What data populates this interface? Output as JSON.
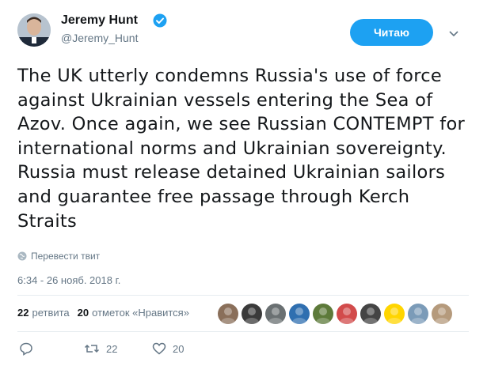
{
  "author": {
    "name": "Jeremy Hunt",
    "handle": "@Jeremy_Hunt",
    "verified": true
  },
  "follow_button": {
    "label": "Читаю"
  },
  "tweet": {
    "text": "The UK utterly condemns Russia's use of force against Ukrainian vessels entering the Sea of Azov. Once again, we see Russian CONTEMPT for international norms and Ukrainian sovereignty. Russia must release detained Ukrainian sailors and guarantee free passage through Kerch Straits",
    "translate_label": "Перевести твит",
    "timestamp": "6:34 - 26 нояб. 2018 г."
  },
  "stats": {
    "retweets_count": "22",
    "retweets_label": "ретвита",
    "likes_count": "20",
    "likes_label": "отметок «Нравится»"
  },
  "likers": [
    {
      "icon": "avatar-photo",
      "color": "#8a6f5a"
    },
    {
      "icon": "avatar-cartoon",
      "color": "#3a3a3a"
    },
    {
      "icon": "avatar-landscape",
      "color": "#6a7072"
    },
    {
      "icon": "avatar-flag",
      "color": "#2f6fb0"
    },
    {
      "icon": "avatar-group",
      "color": "#5d7a3a"
    },
    {
      "icon": "avatar-portrait",
      "color": "#d24b4b"
    },
    {
      "icon": "avatar-car",
      "color": "#444444"
    },
    {
      "icon": "avatar-trident",
      "color": "#ffd500"
    },
    {
      "icon": "avatar-sky",
      "color": "#7b9bb8"
    },
    {
      "icon": "avatar-person",
      "color": "#b59a7c"
    }
  ],
  "actions": {
    "reply_count": "",
    "retweet_count": "22",
    "like_count": "20"
  },
  "colors": {
    "accent": "#1da1f2",
    "text": "#14171a",
    "secondary": "#657786",
    "divider": "#e6ecf0"
  }
}
